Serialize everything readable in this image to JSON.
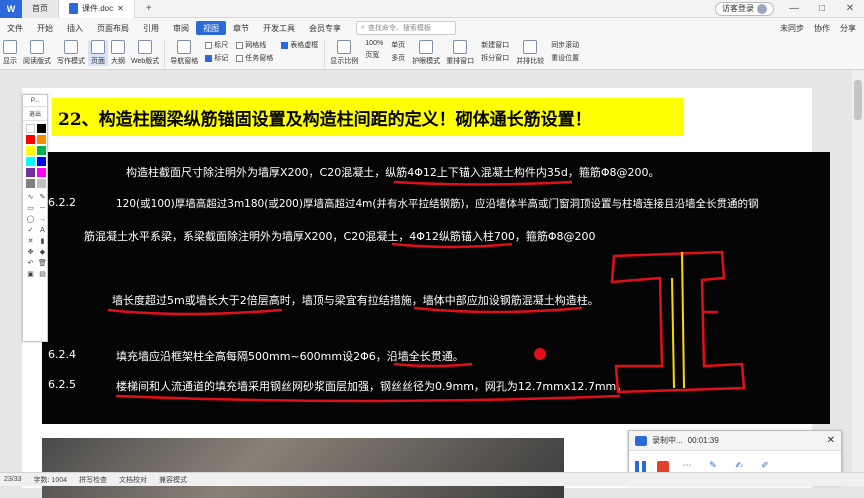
{
  "titlebar": {
    "logo": "W",
    "tabs": [
      {
        "label": "首页"
      },
      {
        "label": "课件.doc"
      }
    ],
    "add_tab": "+",
    "login_label": "访客登录",
    "minimize": "—",
    "maximize": "□",
    "close": "✕"
  },
  "menubar": {
    "file": "文件",
    "items": [
      "开始",
      "插入",
      "页面布局",
      "引用",
      "审阅",
      "视图",
      "章节",
      "开发工具",
      "会员专享"
    ],
    "active": "视图",
    "search_placeholder": "查找命令、搜索模板",
    "right": [
      "未同步",
      "协作",
      "分享"
    ]
  },
  "ribbon": {
    "large_buttons": [
      {
        "label": "显示"
      },
      {
        "label": "阅读版式"
      },
      {
        "label": "写作模式"
      },
      {
        "label": "页面"
      },
      {
        "label": "大纲"
      },
      {
        "label": "Web版式"
      },
      {
        "label": "导航窗格"
      }
    ],
    "checks_row1": [
      {
        "label": "标尺",
        "checked": false
      },
      {
        "label": "网格线",
        "checked": false
      },
      {
        "label": "表格虚框",
        "checked": true
      }
    ],
    "checks_row2": [
      {
        "label": "标记",
        "checked": true
      },
      {
        "label": "任务窗格",
        "checked": false
      }
    ],
    "zoom_buttons": [
      {
        "label": "显示比例"
      },
      {
        "label": "100%"
      },
      {
        "label": "页宽"
      },
      {
        "label": "单页"
      },
      {
        "label": "多页"
      },
      {
        "label": "护眼模式"
      },
      {
        "label": "重排窗口"
      },
      {
        "label": "新建窗口"
      },
      {
        "label": "拆分窗口"
      },
      {
        "label": "并排比较"
      },
      {
        "label": "同步滚动"
      },
      {
        "label": "重设位置"
      }
    ]
  },
  "document": {
    "heading": "22、构造柱圈梁纵筋锚固设置及构造柱间距的定义！砌体通长筋设置！",
    "cad_lines": [
      {
        "num": "",
        "text": "构造柱截面尺寸除注明外为墙厚X200，C20混凝土，纵筋4Φ12上下锚入混凝土构件内35d，箍筋Φ8@200。"
      },
      {
        "num": "6.2.2",
        "text": "120(或100)厚墙高超过3m180(或200)厚墙高超过4m(并有水平拉结钢筋)，应沿墙体半高或门窗洞顶设置与柱墙连接且沿墙全长贯通的钢"
      },
      {
        "num": "",
        "text": "筋混凝土水平系梁，系梁截面除注明外为墙厚X200，C20混凝土，4Φ12纵筋锚入柱700，箍筋Φ8@200"
      },
      {
        "num": "",
        "text": "墙长度超过5m或墙长大于2倍层高时，墙顶与梁宜有拉结措施，墙体中部应加设钢筋混凝土构造柱。"
      },
      {
        "num": "6.2.4",
        "text": "填充墙应沿框架柱全高每隔500mm~600mm设2Φ6，沿墙全长贯通。"
      },
      {
        "num": "6.2.5",
        "text": "楼梯间和人流通道的填充墙采用钢丝网砂浆面层加强，钢丝丝径为0.9mm，网孔为12.7mmx12.7mm。"
      }
    ]
  },
  "palette": {
    "top": "P...",
    "exit": "退出",
    "colors": [
      "#ffffff",
      "#000000",
      "#ff0000",
      "#ff8c00",
      "#ffff00",
      "#00b050",
      "#00ffff",
      "#0000ff",
      "#7030a0",
      "#ff00ff",
      "#808080",
      "#c0c0c0"
    ]
  },
  "recorder": {
    "status": "录制中...",
    "time": "00:01:39",
    "close": "✕"
  },
  "statusbar": {
    "page": "23/33",
    "words": "字数: 1004",
    "spell": "拼写检查",
    "proof": "文档校对",
    "compat": "兼容模式"
  },
  "colors": {
    "accent": "#2b6ad8",
    "highlight": "#ffff00",
    "annotation_red": "#e0101a",
    "annotation_yellow": "#ffd800"
  }
}
